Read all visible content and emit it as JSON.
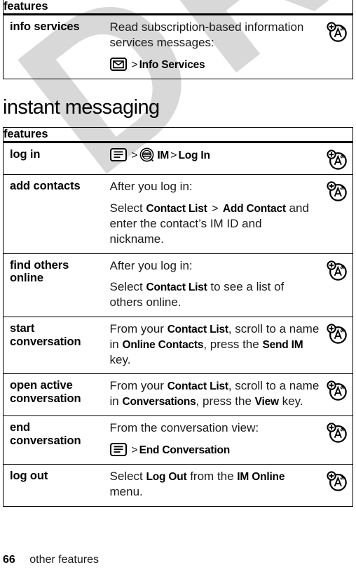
{
  "watermark": {
    "text": "DRAFT"
  },
  "top_table": {
    "header": "features",
    "rows": [
      {
        "label": "info services",
        "lines": [
          {
            "type": "text",
            "parts": [
              {
                "t": "Read subscription-based information services messages:"
              }
            ]
          },
          {
            "type": "path",
            "icon": "message-icon",
            "parts": [
              {
                "t": ">",
                "style": "gt"
              },
              {
                "t": "Info Services",
                "style": "bold"
              }
            ]
          }
        ],
        "icon": "network-personalize-icon"
      }
    ]
  },
  "section": {
    "title": "instant messaging"
  },
  "im_table": {
    "header": "features",
    "rows": [
      {
        "label": "log in",
        "lines": [
          {
            "type": "path",
            "icon": "menu-icon",
            "parts": [
              {
                "t": ">",
                "style": "gt"
              },
              {
                "t": "IM-icon",
                "style": "icon-im"
              },
              {
                "t": "IM",
                "style": "bold"
              },
              {
                "t": ">",
                "style": "gt"
              },
              {
                "t": "Log In",
                "style": "bold"
              }
            ]
          }
        ],
        "icon": "network-personalize-icon"
      },
      {
        "label": "add contacts",
        "lines": [
          {
            "type": "text",
            "parts": [
              {
                "t": "After you log in:"
              }
            ]
          },
          {
            "type": "text",
            "parts": [
              {
                "t": "Select "
              },
              {
                "t": "Contact List",
                "style": "bold"
              },
              {
                "t": " > ",
                "style": "gt"
              },
              {
                "t": "Add Contact",
                "style": "bold"
              },
              {
                "t": " and enter the contact’s IM ID and nickname."
              }
            ]
          }
        ],
        "icon": "network-personalize-icon"
      },
      {
        "label": "find others online",
        "lines": [
          {
            "type": "text",
            "parts": [
              {
                "t": "After you log in:"
              }
            ]
          },
          {
            "type": "text",
            "parts": [
              {
                "t": "Select "
              },
              {
                "t": "Contact List",
                "style": "bold"
              },
              {
                "t": " to see a list of others online."
              }
            ]
          }
        ],
        "icon": "network-personalize-icon"
      },
      {
        "label": "start conversation",
        "lines": [
          {
            "type": "text",
            "parts": [
              {
                "t": "From your "
              },
              {
                "t": "Contact List",
                "style": "bold"
              },
              {
                "t": ", scroll to a name in "
              },
              {
                "t": "Online Contacts",
                "style": "bold"
              },
              {
                "t": ", press the "
              },
              {
                "t": "Send IM",
                "style": "bold"
              },
              {
                "t": " key."
              }
            ]
          }
        ],
        "icon": "network-personalize-icon"
      },
      {
        "label": "open active conversation",
        "lines": [
          {
            "type": "text",
            "parts": [
              {
                "t": "From your "
              },
              {
                "t": "Contact List",
                "style": "bold"
              },
              {
                "t": ", scroll to a name in "
              },
              {
                "t": "Conversations",
                "style": "bold"
              },
              {
                "t": ", press the "
              },
              {
                "t": "View",
                "style": "bold"
              },
              {
                "t": " key."
              }
            ]
          }
        ],
        "icon": "network-personalize-icon"
      },
      {
        "label": "end conversation",
        "lines": [
          {
            "type": "text",
            "parts": [
              {
                "t": "From the conversation view:"
              }
            ]
          },
          {
            "type": "path",
            "icon": "menu-icon",
            "parts": [
              {
                "t": ">",
                "style": "gt"
              },
              {
                "t": "End Conversation",
                "style": "bold"
              }
            ]
          }
        ],
        "icon": "network-personalize-icon"
      },
      {
        "label": "log out",
        "lines": [
          {
            "type": "text",
            "parts": [
              {
                "t": "Select "
              },
              {
                "t": "Log Out",
                "style": "bold"
              },
              {
                "t": " from the "
              },
              {
                "t": "IM Online",
                "style": "bold"
              },
              {
                "t": " menu."
              }
            ]
          }
        ],
        "icon": "network-personalize-icon"
      }
    ]
  },
  "footer": {
    "page_number": "66",
    "running_head": "other features"
  }
}
